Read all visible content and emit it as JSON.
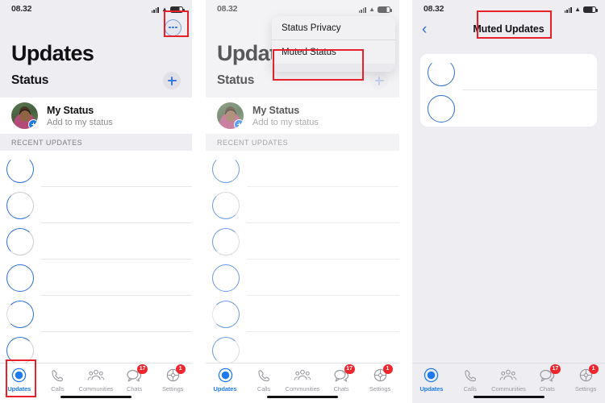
{
  "statusbar": {
    "time": "08.32",
    "wifi_icon": "wifi-icon",
    "signal_icon": "cellular-signal-icon",
    "battery_icon": "battery-icon"
  },
  "panel1": {
    "name": "updates-screen",
    "more_button": "more-options-button",
    "title": "Updates",
    "status_section_label": "Status",
    "add_status_button": "add-status-button",
    "my_status": {
      "title": "My Status",
      "subtitle": "Add to my status"
    },
    "recent_section_label": "RECENT UPDATES",
    "recent_rows": [
      {
        "ring": "r1"
      },
      {
        "ring": "r2"
      },
      {
        "ring": "r3"
      },
      {
        "ring": "r4"
      },
      {
        "ring": "r5"
      },
      {
        "ring": "r6"
      }
    ]
  },
  "panel2": {
    "name": "updates-screen-with-menu",
    "title": "Update",
    "status_section_label": "Status",
    "my_status": {
      "title": "My Status",
      "subtitle": "Add to my status"
    },
    "recent_section_label": "RECENT UPDATES",
    "menu": {
      "items": [
        {
          "label": "Status Privacy",
          "highlighted": false
        },
        {
          "label": "Muted Status",
          "highlighted": true
        }
      ]
    },
    "recent_rows": [
      {
        "ring": "r1"
      },
      {
        "ring": "r2"
      },
      {
        "ring": "r3"
      },
      {
        "ring": "r4"
      },
      {
        "ring": "r5"
      },
      {
        "ring": "r6"
      }
    ]
  },
  "panel3": {
    "name": "muted-updates-screen",
    "back_button": "back-button",
    "title": "Muted Updates",
    "rows": [
      {
        "ring": "r1"
      },
      {
        "ring": "r4"
      }
    ]
  },
  "tabbar": {
    "tabs": [
      {
        "label": "Updates",
        "icon": "updates-icon",
        "active": true,
        "badge": ""
      },
      {
        "label": "Calls",
        "icon": "phone-icon",
        "active": false,
        "badge": ""
      },
      {
        "label": "Communities",
        "icon": "communities-icon",
        "active": false,
        "badge": ""
      },
      {
        "label": "Chats",
        "icon": "chats-icon",
        "active": false,
        "badge": "17"
      },
      {
        "label": "Settings",
        "icon": "settings-gear-icon",
        "active": false,
        "badge": "1"
      }
    ]
  },
  "colors": {
    "accent_blue": "#1e7af0",
    "badge_red": "#f0262e",
    "annotation_red": "#e8202a",
    "panel_grey": "#eeeef2"
  },
  "annotations": [
    {
      "name": "highlight-more-button"
    },
    {
      "name": "highlight-updates-tab"
    },
    {
      "name": "highlight-muted-status-menu-item"
    },
    {
      "name": "highlight-muted-updates-title"
    }
  ]
}
